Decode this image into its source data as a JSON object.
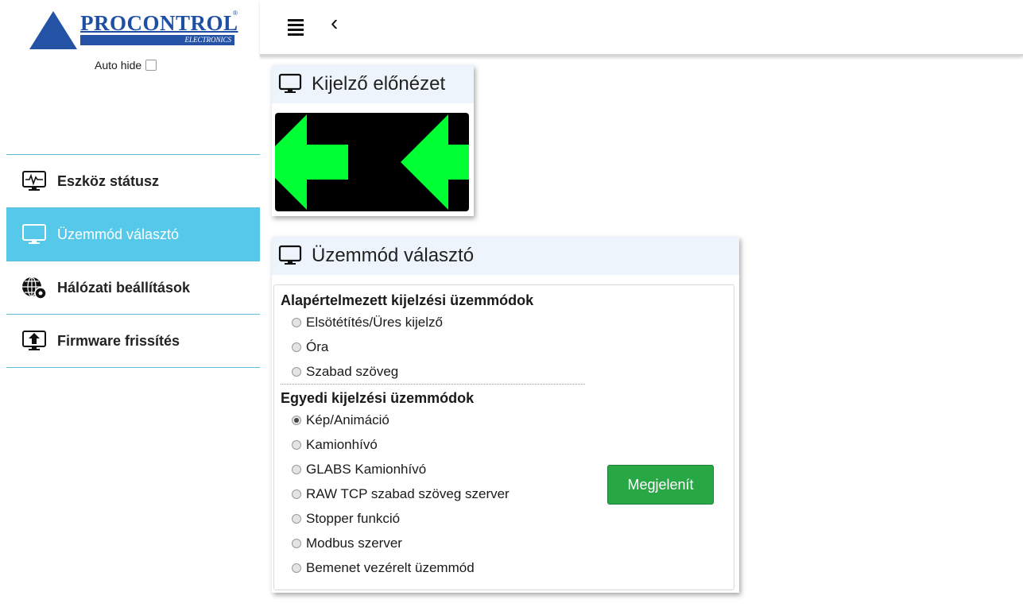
{
  "logo": {
    "brand": "PROCONTROL",
    "sub": "ELECTRONICS",
    "reg": "®"
  },
  "sidebar": {
    "autohide_label": "Auto hide",
    "items": [
      {
        "label": "Eszköz státusz",
        "icon": "monitor-pulse-icon"
      },
      {
        "label": "Üzemmód választó",
        "icon": "monitor-icon",
        "active": true
      },
      {
        "label": "Hálózati beállítások",
        "icon": "globe-gear-icon"
      },
      {
        "label": "Firmware frissítés",
        "icon": "upload-monitor-icon"
      }
    ]
  },
  "topbar": {
    "menu_icon": "hamburger-icon",
    "back_icon": "chevron-left-icon",
    "back_glyph": "‹"
  },
  "preview": {
    "title": "Kijelző előnézet",
    "icon": "monitor-icon",
    "arrow_color": "#00ff33"
  },
  "mode": {
    "title": "Üzemmód választó",
    "default_group": "Alapértelmezett kijelzési üzemmódok",
    "default_options": [
      "Elsötétítés/Üres kijelző",
      "Óra",
      "Szabad szöveg"
    ],
    "custom_group": "Egyedi kijelzési üzemmódok",
    "custom_options": [
      "Kép/Animáció",
      "Kamionhívó",
      "GLABS Kamionhívó",
      "RAW TCP szabad szöveg szerver",
      "Stopper funkció",
      "Modbus szerver",
      "Bemenet vezérelt üzemmód"
    ],
    "selected": "Kép/Animáció",
    "button_label": "Megjelenít",
    "button_color": "#28a745"
  }
}
